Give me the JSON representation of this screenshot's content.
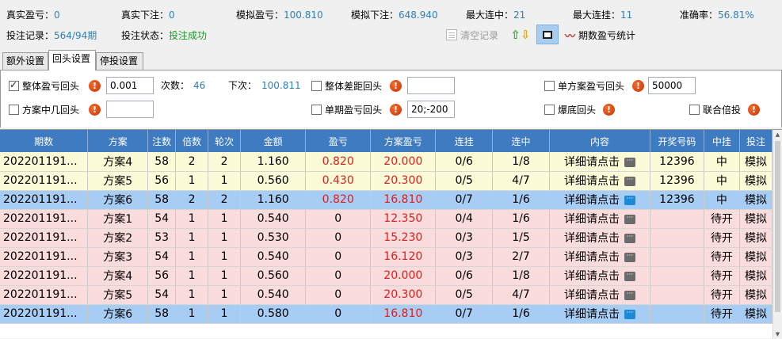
{
  "stats": {
    "real_profit_label": "真实盈亏：",
    "real_profit": "0",
    "real_bet_label": "真实下注：",
    "real_bet": "0",
    "sim_profit_label": "模拟盈亏：",
    "sim_profit": "100.810",
    "sim_bet_label": "模拟下注：",
    "sim_bet": "648.940",
    "max_win_streak_label": "最大连中：",
    "max_win_streak": "21",
    "max_lose_streak_label": "最大连挂：",
    "max_lose_streak": "11",
    "accuracy_label": "准确率：",
    "accuracy": "56.81%",
    "bet_record_label": "投注记录：",
    "bet_record": "564/94期",
    "bet_status_label": "投注状态：",
    "bet_status": "投注成功"
  },
  "toolbar": {
    "clear_label": "清空记录",
    "stats_label": "期数盈亏统计",
    "up_arrow": "⇧",
    "down_arrow": "⇩",
    "stats_icon": "〰"
  },
  "tabs": [
    "额外设置",
    "回头设置",
    "停投设置"
  ],
  "settings": {
    "overall_profit_label": "整体盈亏回头",
    "overall_profit_value": "0.001",
    "count_label": "次数：",
    "count_value": "46",
    "next_label": "下次：",
    "next_value": "100.811",
    "overall_gap_label": "整体差距回头",
    "overall_gap_value": "",
    "single_plan_label": "单方案盈亏回头",
    "single_plan_value": "50000",
    "plan_hits_label": "方案中几回头",
    "plan_hits_value": "",
    "single_period_label": "单期盈亏回头",
    "single_period_value": "20;-200",
    "bust_label": "爆底回头",
    "combined_label": "联合倍投",
    "info_glyph": "!"
  },
  "table": {
    "columns": [
      "期数",
      "方案",
      "注数",
      "倍数",
      "轮次",
      "金额",
      "盈亏",
      "方案盈亏",
      "连挂",
      "连中",
      "内容",
      "开奖号码",
      "中挂",
      "投注"
    ],
    "rows": [
      {
        "style": "yellow",
        "cells": [
          "202201191...",
          "方案4",
          "58",
          "2",
          "2",
          "1.160",
          "0.820",
          "20.000",
          "0/6",
          "1/8",
          "详细请点击",
          "12396",
          "中",
          "模拟"
        ]
      },
      {
        "style": "yellow",
        "cells": [
          "202201191...",
          "方案5",
          "56",
          "1",
          "1",
          "0.560",
          "0.430",
          "20.300",
          "0/5",
          "4/7",
          "详细请点击",
          "12396",
          "中",
          "模拟"
        ]
      },
      {
        "style": "selected",
        "cells": [
          "202201191...",
          "方案6",
          "58",
          "2",
          "2",
          "1.160",
          "0.820",
          "16.810",
          "0/7",
          "1/6",
          "详细请点击",
          "12396",
          "中",
          "模拟"
        ]
      },
      {
        "style": "pink",
        "cells": [
          "202201191...",
          "方案1",
          "54",
          "1",
          "1",
          "0.540",
          "0",
          "12.350",
          "0/4",
          "1/6",
          "详细请点击",
          "",
          "待开",
          "模拟"
        ]
      },
      {
        "style": "pink",
        "cells": [
          "202201191...",
          "方案2",
          "53",
          "1",
          "1",
          "0.530",
          "0",
          "15.230",
          "0/3",
          "1/5",
          "详细请点击",
          "",
          "待开",
          "模拟"
        ]
      },
      {
        "style": "pink",
        "cells": [
          "202201191...",
          "方案3",
          "54",
          "1",
          "1",
          "0.540",
          "0",
          "16.120",
          "0/3",
          "2/7",
          "详细请点击",
          "",
          "待开",
          "模拟"
        ]
      },
      {
        "style": "pink",
        "cells": [
          "202201191...",
          "方案4",
          "56",
          "1",
          "1",
          "0.560",
          "0",
          "20.000",
          "0/6",
          "1/8",
          "详细请点击",
          "",
          "待开",
          "模拟"
        ]
      },
      {
        "style": "pink",
        "cells": [
          "202201191...",
          "方案5",
          "54",
          "1",
          "1",
          "0.540",
          "0",
          "20.300",
          "0/5",
          "4/7",
          "详细请点击",
          "",
          "待开",
          "模拟"
        ]
      },
      {
        "style": "selected",
        "cells": [
          "202201191...",
          "方案6",
          "58",
          "1",
          "1",
          "0.580",
          "0",
          "16.810",
          "0/7",
          "1/6",
          "详细请点击",
          "",
          "待开",
          "模拟"
        ]
      }
    ]
  },
  "colors": {
    "accent_blue": "#2e7fb8",
    "header_blue": "#3f7bc1",
    "status_green": "#1a9a2a",
    "profit_red": "#e31b1b"
  }
}
